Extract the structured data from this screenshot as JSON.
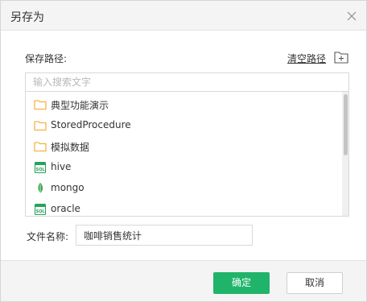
{
  "dialog": {
    "title": "另存为",
    "close_icon": "close-icon"
  },
  "path": {
    "label": "保存路径:",
    "clear_label": "清空路径",
    "new_folder_icon": "new-folder-icon"
  },
  "search": {
    "placeholder": "输入搜索文字",
    "value": ""
  },
  "tree": {
    "items": [
      {
        "label": "典型功能演示",
        "icon": "folder-icon"
      },
      {
        "label": "StoredProcedure",
        "icon": "folder-icon"
      },
      {
        "label": "模拟数据",
        "icon": "folder-icon"
      },
      {
        "label": "hive",
        "icon": "sql-database-icon"
      },
      {
        "label": "mongo",
        "icon": "mongo-leaf-icon"
      },
      {
        "label": "oracle",
        "icon": "sql-database-icon"
      }
    ]
  },
  "filename": {
    "label": "文件名称:",
    "value": "咖啡销售统计"
  },
  "footer": {
    "ok_label": "确定",
    "cancel_label": "取消"
  },
  "colors": {
    "accent": "#20b46b",
    "folder": "#f5a623",
    "sql_icon": "#27a35a",
    "mongo_icon": "#3aa346"
  }
}
